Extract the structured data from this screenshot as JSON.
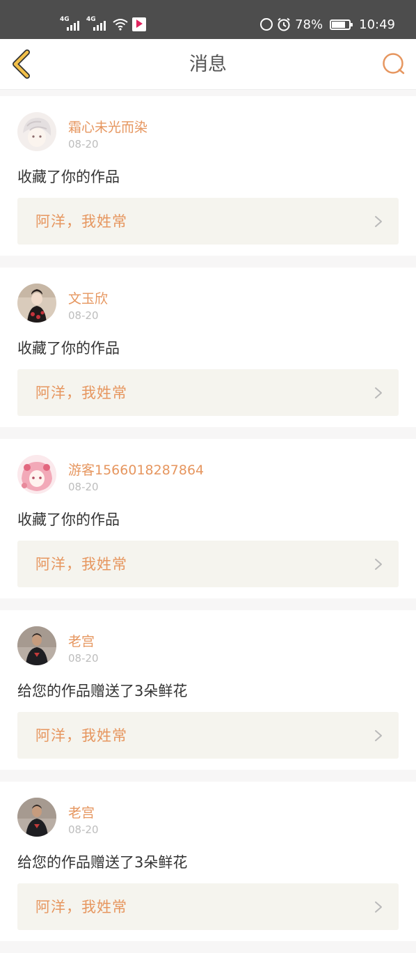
{
  "status_bar": {
    "network_left": "4G",
    "network_right": "4G",
    "battery": "78%",
    "battery_level": 0.78,
    "time": "10:49"
  },
  "header": {
    "title": "消息"
  },
  "colors": {
    "accent": "#e6965f",
    "back_arrow": "#f2c04a",
    "work_box": "#f5f4ee",
    "status_bar": "#4d4d4d"
  },
  "messages": [
    {
      "user": "霜心未光而染",
      "date": "08-20",
      "action": "收藏了你的作品",
      "work": "阿洋，我姓常"
    },
    {
      "user": "文玉欣",
      "date": "08-20",
      "action": "收藏了你的作品",
      "work": "阿洋，我姓常"
    },
    {
      "user": "游客1566018287864",
      "date": "08-20",
      "action": "收藏了你的作品",
      "work": "阿洋，我姓常"
    },
    {
      "user": "老宫",
      "date": "08-20",
      "action": "给您的作品赠送了3朵鲜花",
      "work": "阿洋，我姓常"
    },
    {
      "user": "老宫",
      "date": "08-20",
      "action": "给您的作品赠送了3朵鲜花",
      "work": "阿洋，我姓常"
    }
  ]
}
